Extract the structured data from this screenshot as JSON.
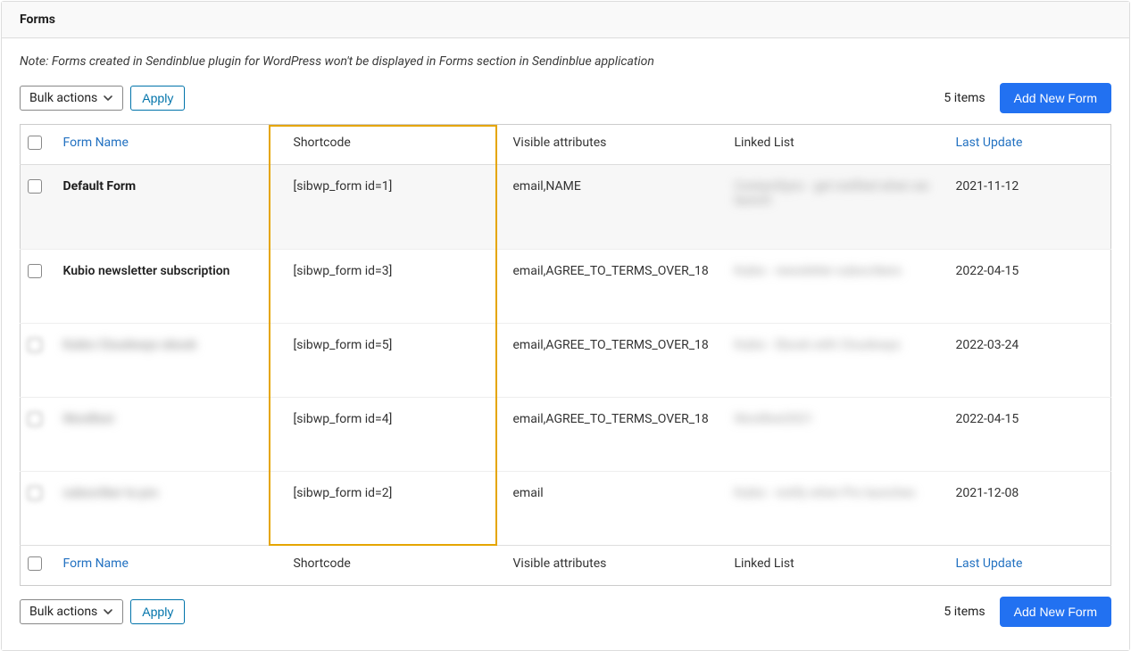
{
  "panel": {
    "title": "Forms"
  },
  "note": "Note: Forms created in Sendinblue plugin for WordPress won't be displayed in Forms section in Sendinblue application",
  "toolbar": {
    "bulk_label": "Bulk actions",
    "apply_label": "Apply",
    "count_text": "5 items",
    "add_new_label": "Add New Form"
  },
  "columns": {
    "name": "Form Name",
    "shortcode": "Shortcode",
    "attrs": "Visible attributes",
    "list": "Linked List",
    "date": "Last Update"
  },
  "rows": [
    {
      "name": "Default Form",
      "shortcode": "[sibwp_form id=1]",
      "attrs": "email,NAME",
      "list": "ContactSync · get notified when we launch",
      "date": "2021-11-12",
      "blur_name": false,
      "blur_check": false,
      "blur_list": true,
      "first": true
    },
    {
      "name": "Kubio newsletter subscription",
      "shortcode": "[sibwp_form id=3]",
      "attrs": "email,AGREE_TO_TERMS_OVER_18",
      "list": "Kubio · newsletter subscribers",
      "date": "2022-04-15",
      "blur_name": false,
      "blur_check": false,
      "blur_list": true,
      "first": false
    },
    {
      "name": "Kubio Cloudways ebook",
      "shortcode": "[sibwp_form id=5]",
      "attrs": "email,AGREE_TO_TERMS_OVER_18",
      "list": "Kubio · Ebook with Cloudways",
      "date": "2022-03-24",
      "blur_name": true,
      "blur_check": true,
      "blur_list": true,
      "first": false
    },
    {
      "name": "Wordfest",
      "shortcode": "[sibwp_form id=4]",
      "attrs": "email,AGREE_TO_TERMS_OVER_18",
      "list": "Wordfest2021",
      "date": "2022-04-15",
      "blur_name": true,
      "blur_check": true,
      "blur_list": true,
      "first": false
    },
    {
      "name": "subscriber to pro",
      "shortcode": "[sibwp_form id=2]",
      "attrs": "email",
      "list": "Kubio · notify when Pro launches",
      "date": "2021-12-08",
      "blur_name": true,
      "blur_check": true,
      "blur_list": true,
      "first": false
    }
  ]
}
